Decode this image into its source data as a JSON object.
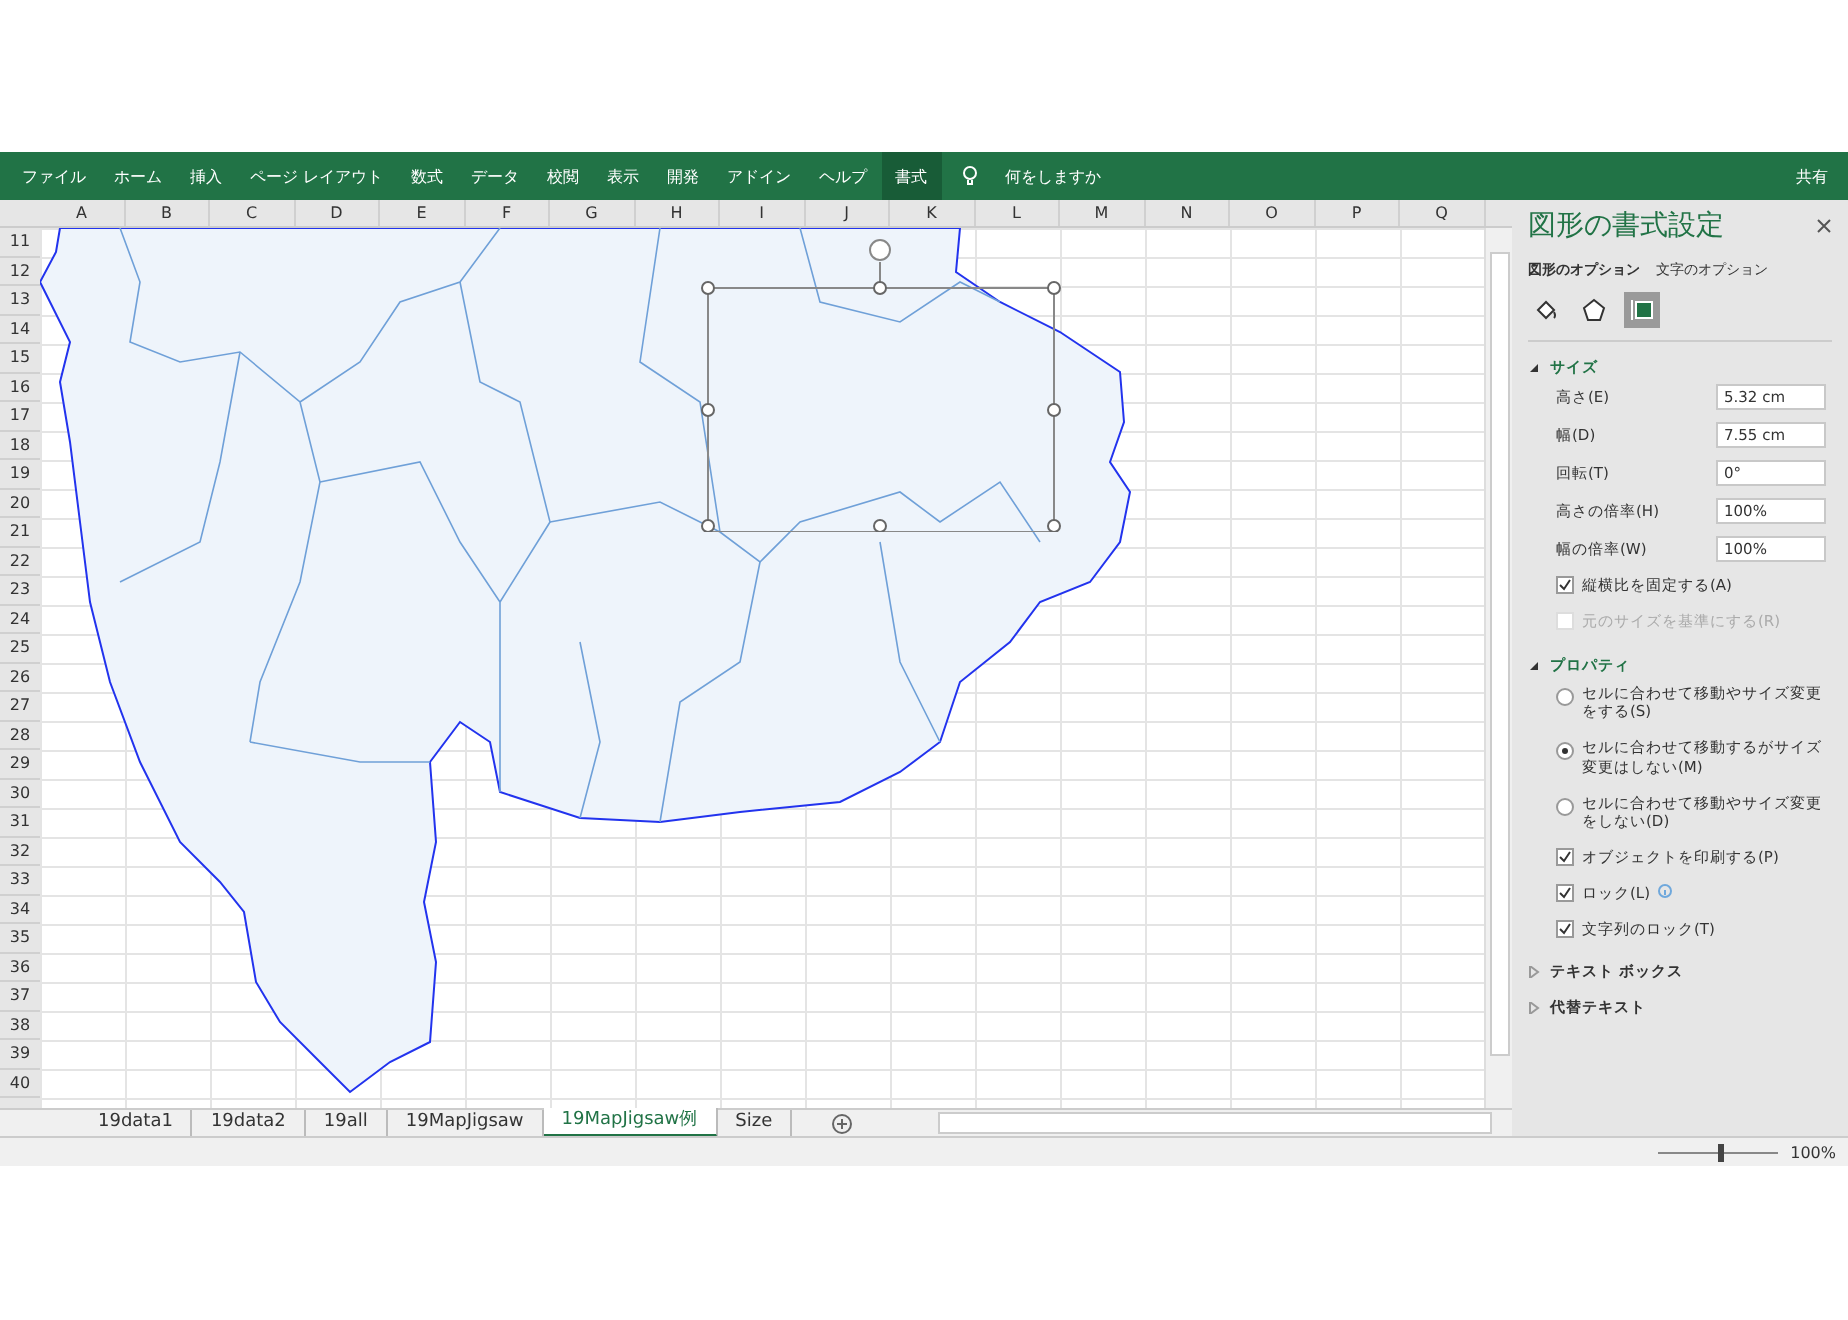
{
  "ribbon": {
    "tabs": [
      {
        "label": "ファイル",
        "selected": false
      },
      {
        "label": "ホーム",
        "selected": false
      },
      {
        "label": "挿入",
        "selected": false
      },
      {
        "label": "ページ レイアウト",
        "selected": false
      },
      {
        "label": "数式",
        "selected": false
      },
      {
        "label": "データ",
        "selected": false
      },
      {
        "label": "校閲",
        "selected": false
      },
      {
        "label": "表示",
        "selected": false
      },
      {
        "label": "開発",
        "selected": false
      },
      {
        "label": "アドイン",
        "selected": false
      },
      {
        "label": "ヘルプ",
        "selected": false
      },
      {
        "label": "書式",
        "selected": true
      }
    ],
    "tell_me": "何をしますか",
    "share": "共有"
  },
  "sheet": {
    "columns": [
      "A",
      "B",
      "C",
      "D",
      "E",
      "F",
      "G",
      "H",
      "I",
      "J",
      "K",
      "L",
      "M",
      "N",
      "O",
      "P",
      "Q"
    ],
    "rows": [
      "11",
      "12",
      "13",
      "14",
      "15",
      "16",
      "17",
      "18",
      "19",
      "20",
      "21",
      "22",
      "23",
      "24",
      "25",
      "26",
      "27",
      "28",
      "29",
      "30",
      "31",
      "32",
      "33",
      "34",
      "35",
      "36",
      "37",
      "38",
      "39",
      "40"
    ]
  },
  "panel": {
    "title": "図形の書式設定",
    "tabs": [
      {
        "label": "図形のオプション",
        "selected": true
      },
      {
        "label": "文字のオプション",
        "selected": false
      }
    ],
    "icon_tabs": [
      {
        "kind": "fill",
        "selected": false
      },
      {
        "kind": "shape",
        "selected": false
      },
      {
        "kind": "size",
        "selected": true
      }
    ],
    "sections": [
      {
        "kind": "size",
        "title": "サイズ",
        "expanded": true,
        "fields": [
          {
            "label": "高さ(E)",
            "value": "5.32 cm"
          },
          {
            "label": "幅(D)",
            "value": "7.55 cm"
          },
          {
            "label": "回転(T)",
            "value": "0°"
          },
          {
            "label": "高さの倍率(H)",
            "value": "100%"
          },
          {
            "label": "幅の倍率(W)",
            "value": "100%"
          }
        ],
        "checkboxes": [
          {
            "label": "縦横比を固定する(A)",
            "checked": true,
            "disabled": false
          },
          {
            "label": "元のサイズを基準にする(R)",
            "checked": false,
            "disabled": true
          }
        ]
      },
      {
        "kind": "properties",
        "title": "プロパティ",
        "expanded": true,
        "radios": [
          {
            "label": "セルに合わせて移動やサイズ変更をする(S)",
            "selected": false
          },
          {
            "label": "セルに合わせて移動するがサイズ変更はしない(M)",
            "selected": true
          },
          {
            "label": "セルに合わせて移動やサイズ変更をしない(D)",
            "selected": false
          }
        ],
        "checkboxes": [
          {
            "label": "オブジェクトを印刷する(P)",
            "checked": true,
            "info": false
          },
          {
            "label": "ロック(L)",
            "checked": true,
            "info": true
          },
          {
            "label": "文字列のロック(T)",
            "checked": true,
            "info": false
          }
        ]
      },
      {
        "kind": "collapsed",
        "title": "テキスト ボックス",
        "expanded": false
      },
      {
        "kind": "collapsed",
        "title": "代替テキスト",
        "expanded": false
      }
    ]
  },
  "sheet_tabs": [
    {
      "label": "19data1",
      "selected": false
    },
    {
      "label": "19data2",
      "selected": false
    },
    {
      "label": "19all",
      "selected": false
    },
    {
      "label": "19MapJigsaw",
      "selected": false
    },
    {
      "label": "19MapJigsaw例",
      "selected": true
    },
    {
      "label": "Size",
      "selected": false
    }
  ],
  "status_bar": {
    "zoom": "100%",
    "level": 0.5
  }
}
